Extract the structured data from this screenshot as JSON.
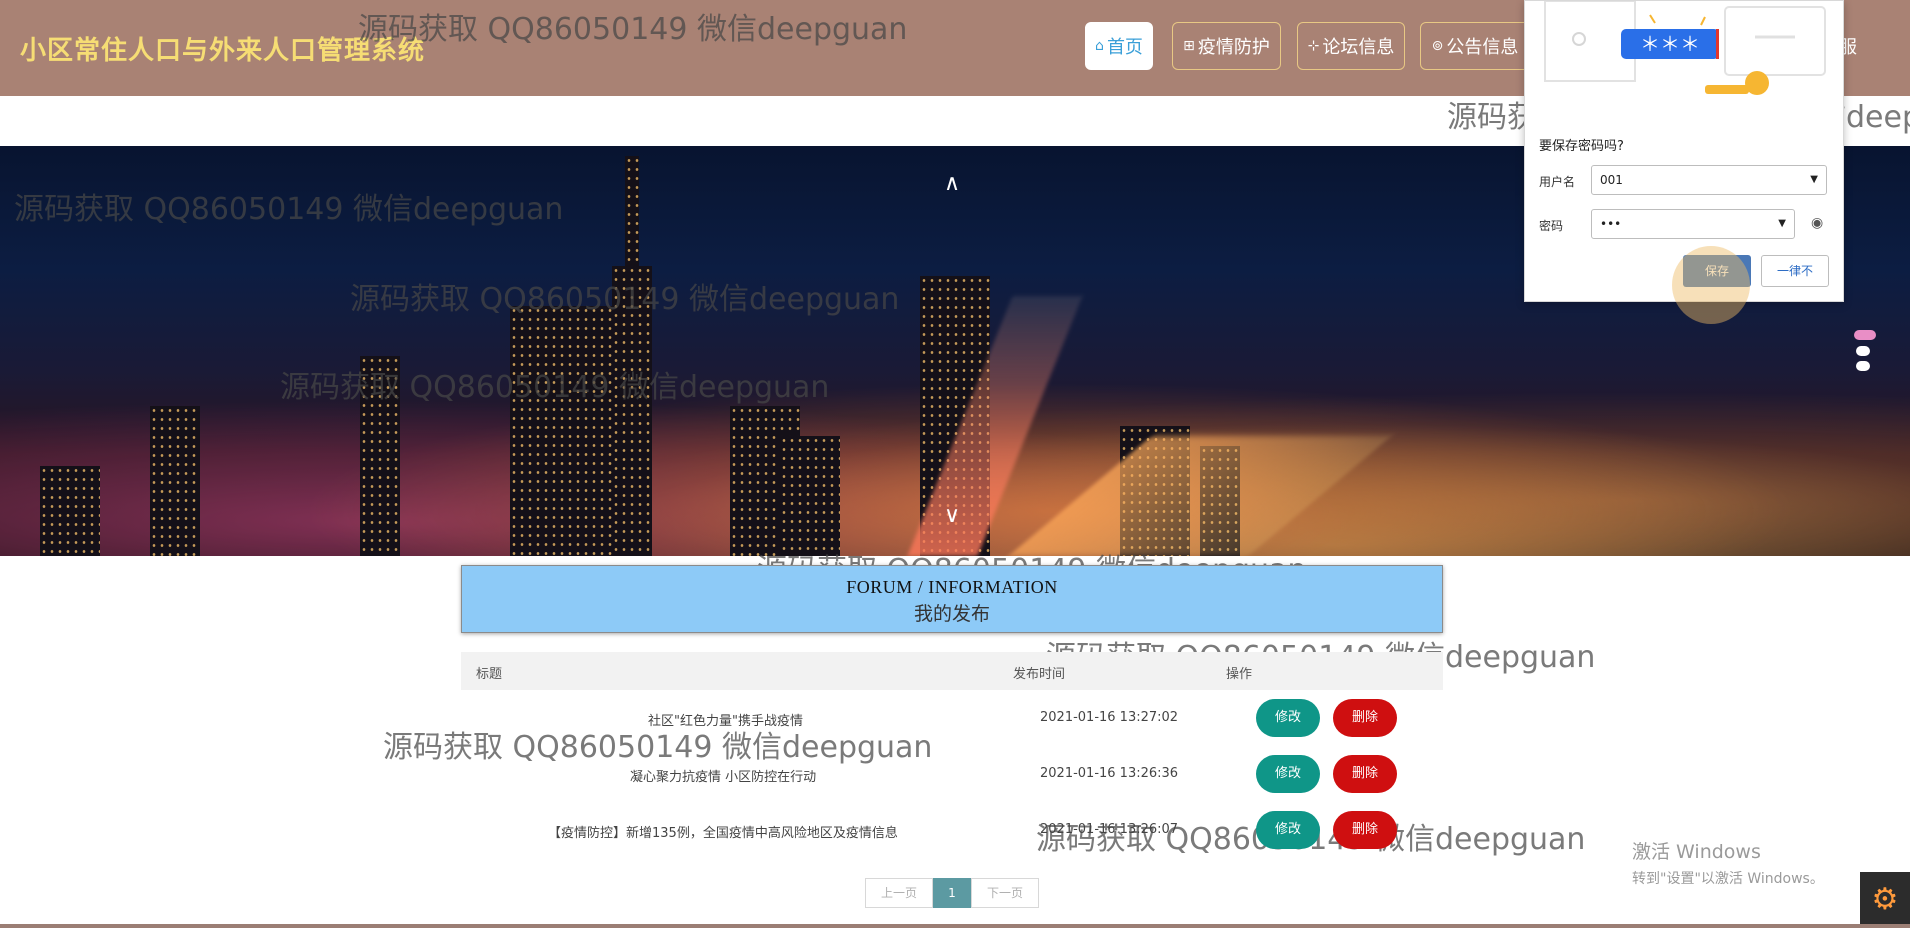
{
  "header": {
    "site_title": "小区常住人口与外来人口管理系统",
    "nav": [
      {
        "icon": "home-icon",
        "label": "首页"
      },
      {
        "icon": "gift-icon",
        "label": "疫情防护"
      },
      {
        "icon": "grid-icon",
        "label": "论坛信息"
      },
      {
        "icon": "broadcast-icon",
        "label": "公告信息"
      },
      {
        "icon": "service-icon",
        "label": "服"
      }
    ]
  },
  "watermark": "源码获取 QQ86050149 微信deepguan",
  "watermark_cut": "源码获取 QQ86050149 微信deep",
  "password_popup": {
    "masked_banner": "＊＊＊",
    "title": "要保存密码吗?",
    "username_label": "用户名",
    "username_value": "001",
    "password_label": "密码",
    "password_value": "•••",
    "save_label": "保存",
    "never_label": "一律不"
  },
  "forum": {
    "heading_en": "FORUM / INFORMATION",
    "heading_zh": "我的发布",
    "columns": [
      "标题",
      "发布时间",
      "操作"
    ],
    "rows": [
      {
        "title": "社区\"红色力量\"携手战疫情",
        "time": "2021-01-16 13:27:02",
        "edit": "修改",
        "delete": "删除"
      },
      {
        "title": "凝心聚力抗疫情 小区防控在行动",
        "time": "2021-01-16 13:26:36",
        "edit": "修改",
        "delete": "删除"
      },
      {
        "title": "【疫情防控】新增135例，全国疫情中高风险地区及疫情信息",
        "time": "2021-01-16 13:26:07",
        "edit": "修改",
        "delete": "删除"
      }
    ]
  },
  "pagination": {
    "prev": "上一页",
    "current": "1",
    "next": "下一页"
  },
  "windows_activation": {
    "line1": "激活 Windows",
    "line2": "转到\"设置\"以激活 Windows。"
  },
  "colors": {
    "header_bg": "#a98274",
    "title_color": "#f6dd74",
    "banner_bg": "#8dcaf7",
    "edit_btn": "#0f9688",
    "delete_btn": "#cf0f10",
    "pager_current": "#5c9aa2"
  }
}
